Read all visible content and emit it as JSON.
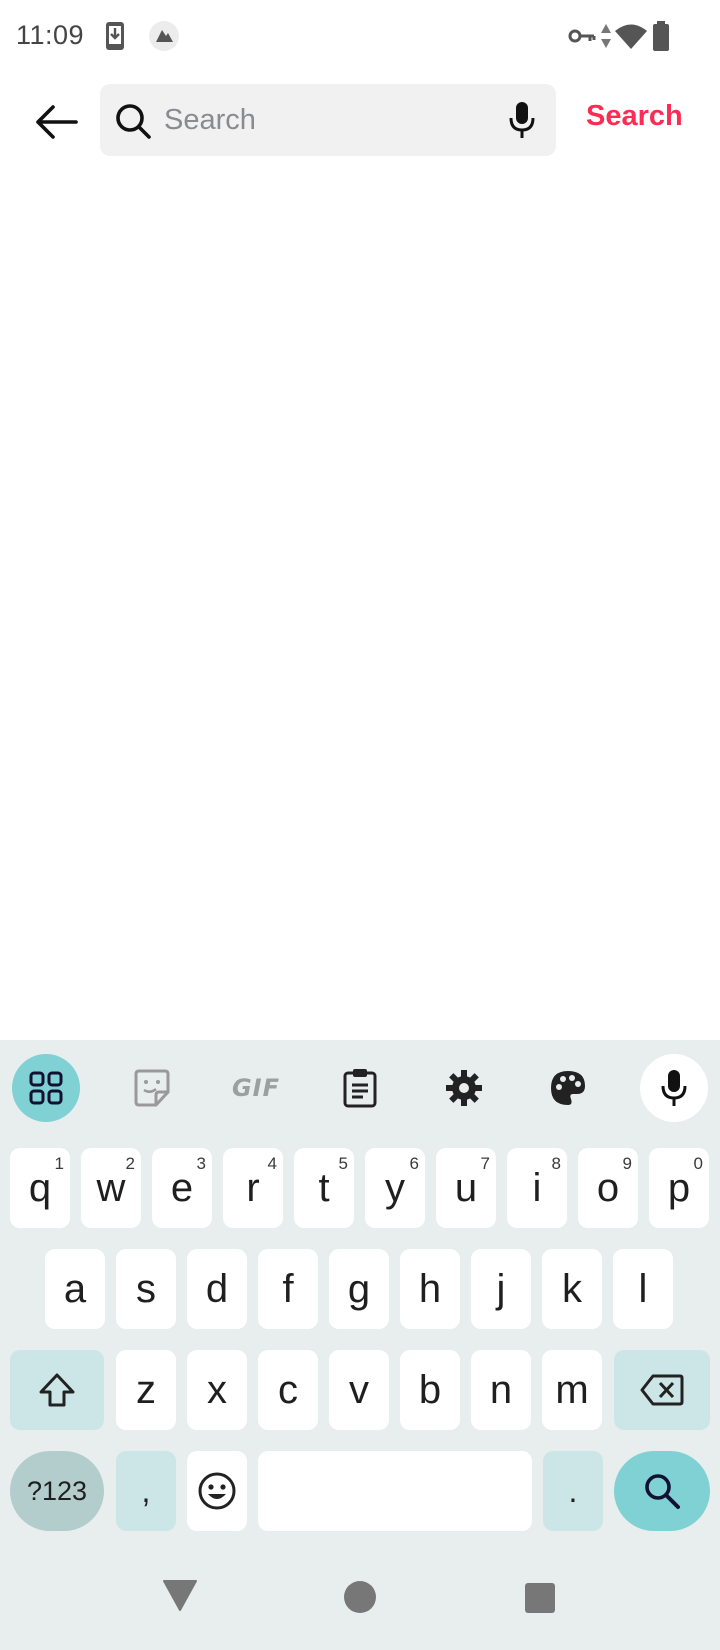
{
  "status_bar": {
    "time": "11:09"
  },
  "search": {
    "placeholder": "Search",
    "value": "",
    "action_label": "Search"
  },
  "icons": {
    "back": "arrow-left-icon",
    "search": "magnifier-icon",
    "voice": "microphone-icon"
  },
  "keyboard": {
    "row1": [
      {
        "key": "q",
        "hint": "1"
      },
      {
        "key": "w",
        "hint": "2"
      },
      {
        "key": "e",
        "hint": "3"
      },
      {
        "key": "r",
        "hint": "4"
      },
      {
        "key": "t",
        "hint": "5"
      },
      {
        "key": "y",
        "hint": "6"
      },
      {
        "key": "u",
        "hint": "7"
      },
      {
        "key": "i",
        "hint": "8"
      },
      {
        "key": "o",
        "hint": "9"
      },
      {
        "key": "p",
        "hint": "0"
      }
    ],
    "row2": [
      "a",
      "s",
      "d",
      "f",
      "g",
      "h",
      "j",
      "k",
      "l"
    ],
    "row3": [
      "z",
      "x",
      "c",
      "v",
      "b",
      "n",
      "m"
    ],
    "symbols_label": "?123",
    "comma_label": ",",
    "period_label": ".",
    "gif_label": "GIF"
  },
  "colors": {
    "accent": "#fe2c55",
    "keyboard_bg": "#e8eeee",
    "keyboard_accent": "#7fd1d4",
    "modifier_key": "#cce6e8"
  }
}
